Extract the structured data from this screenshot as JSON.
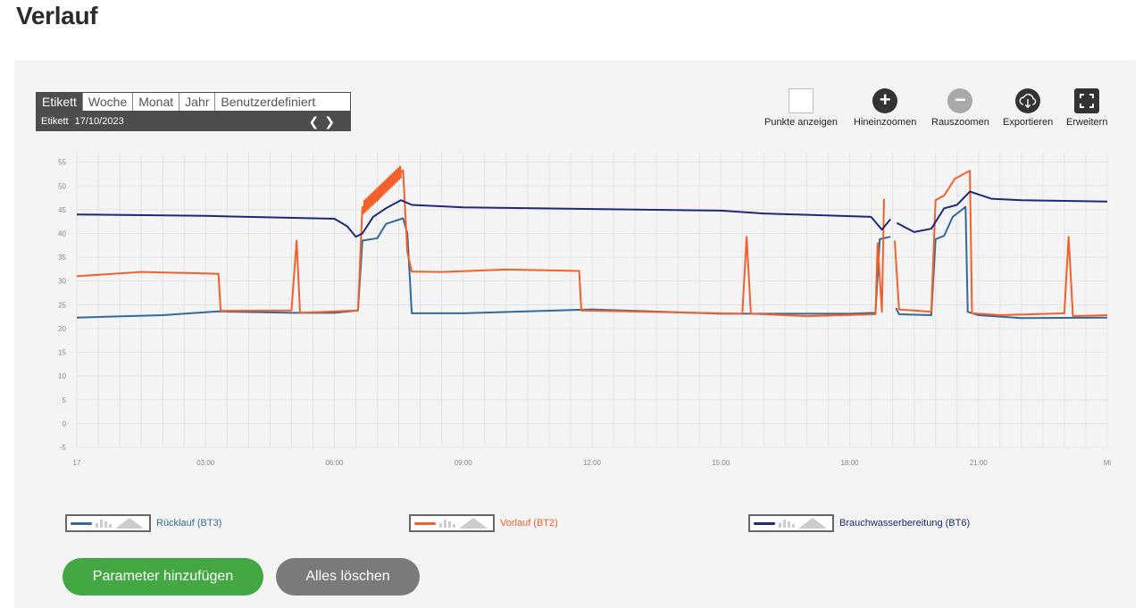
{
  "page": {
    "title": "Verlauf"
  },
  "period_tabs": [
    "Etikett",
    "Woche",
    "Monat",
    "Jahr",
    "Benutzerdefiniert"
  ],
  "date_bar": {
    "label": "Etikett",
    "date": "17/10/2023"
  },
  "toolbar": {
    "points": "Punkte anzeigen",
    "zoom_in": "Hineinzoomen",
    "zoom_out": "Rauszoomen",
    "export": "Exportieren",
    "expand": "Erweitern"
  },
  "colors": {
    "ruecklauf": "#336a9c",
    "vorlauf": "#f4602a",
    "brauchwasser": "#1c2a78"
  },
  "chart_data": {
    "type": "line",
    "x_unit": "hours",
    "x_ticks": [
      "17",
      "03:00",
      "06:00",
      "09:00",
      "12:00",
      "15:00",
      "18:00",
      "21:00",
      "Mi"
    ],
    "ylim": [
      -5,
      57
    ],
    "y_ticks": [
      -5,
      0,
      5,
      10,
      15,
      20,
      25,
      30,
      35,
      40,
      45,
      50,
      55
    ],
    "grid": true,
    "legend_position": "bottom",
    "series": [
      {
        "name": "Rücklauf (BT3)",
        "color": "#336a9c",
        "points": [
          [
            0,
            22.3
          ],
          [
            2,
            22.8
          ],
          [
            3.3,
            23.6
          ],
          [
            5,
            23.3
          ],
          [
            6,
            23.3
          ],
          [
            6.55,
            23.8
          ],
          [
            6.65,
            38.5
          ],
          [
            7.0,
            39
          ],
          [
            7.2,
            42
          ],
          [
            7.6,
            43.2
          ],
          [
            7.7,
            40
          ],
          [
            7.8,
            23.2
          ],
          [
            9,
            23.2
          ],
          [
            12,
            24
          ],
          [
            15,
            23.1
          ],
          [
            18,
            23.1
          ],
          [
            18.6,
            23.3
          ],
          [
            18.7,
            38.8
          ],
          [
            18.95,
            39.3
          ],
          [
            null,
            null
          ],
          [
            19.08,
            24.3
          ],
          [
            19.15,
            23
          ],
          [
            19.9,
            22.8
          ],
          [
            20.0,
            38.8
          ],
          [
            20.2,
            39.5
          ],
          [
            20.4,
            43.5
          ],
          [
            20.7,
            45.6
          ],
          [
            20.75,
            23.5
          ],
          [
            21,
            22.8
          ],
          [
            22,
            22.2
          ],
          [
            24,
            22.3
          ]
        ]
      },
      {
        "name": "Vorlauf (BT2)",
        "color": "#f4602a",
        "points": [
          [
            0,
            31
          ],
          [
            1.5,
            31.9
          ],
          [
            3,
            31.6
          ],
          [
            3.3,
            31.5
          ],
          [
            3.35,
            23.7
          ],
          [
            5.0,
            23.8
          ],
          [
            5.12,
            38.5
          ],
          [
            5.2,
            23.3
          ],
          [
            6.55,
            23.8
          ],
          [
            6.65,
            45.5
          ],
          [
            7.0,
            47
          ],
          [
            7.35,
            51
          ],
          [
            7.6,
            53.3
          ],
          [
            7.7,
            36
          ],
          [
            7.8,
            32
          ],
          [
            8.5,
            31.9
          ],
          [
            10,
            32.4
          ],
          [
            11.7,
            32.1
          ],
          [
            11.75,
            23.8
          ],
          [
            15.5,
            23.1
          ],
          [
            15.6,
            39.3
          ],
          [
            15.7,
            23.1
          ],
          [
            17,
            22.6
          ],
          [
            18.6,
            23
          ],
          [
            18.65,
            38
          ],
          [
            18.75,
            23.5
          ],
          [
            18.8,
            47.3
          ],
          [
            null,
            null
          ],
          [
            19.05,
            38.5
          ],
          [
            19.15,
            24
          ],
          [
            19.9,
            23.5
          ],
          [
            20.0,
            47
          ],
          [
            20.2,
            48
          ],
          [
            20.45,
            51.5
          ],
          [
            20.8,
            53.2
          ],
          [
            20.85,
            23.2
          ],
          [
            21.5,
            22.8
          ],
          [
            23,
            23.2
          ],
          [
            23.1,
            39.3
          ],
          [
            23.2,
            22.6
          ],
          [
            24,
            22.8
          ]
        ]
      },
      {
        "name": "Brauchwasserbereitung (BT6)",
        "color": "#1c2a78",
        "points": [
          [
            0,
            44
          ],
          [
            3,
            43.7
          ],
          [
            6,
            43.1
          ],
          [
            6.3,
            41.5
          ],
          [
            6.5,
            39.3
          ],
          [
            6.65,
            40
          ],
          [
            6.9,
            43.5
          ],
          [
            7.2,
            45.3
          ],
          [
            7.55,
            47
          ],
          [
            7.8,
            46
          ],
          [
            9,
            45.5
          ],
          [
            15,
            44.8
          ],
          [
            16,
            44.2
          ],
          [
            18.5,
            43.5
          ],
          [
            18.75,
            40.8
          ],
          [
            18.95,
            43
          ],
          [
            null,
            null
          ],
          [
            19.1,
            42.2
          ],
          [
            19.5,
            40.3
          ],
          [
            19.9,
            41
          ],
          [
            20.2,
            45.3
          ],
          [
            20.5,
            46
          ],
          [
            20.8,
            48.8
          ],
          [
            21.3,
            47.3
          ],
          [
            22,
            47
          ],
          [
            24,
            46.7
          ]
        ]
      }
    ]
  },
  "legend": [
    {
      "label": "Rücklauf (BT3)",
      "color": "#336a9c"
    },
    {
      "label": "Vorlauf (BT2)",
      "color": "#f4602a"
    },
    {
      "label": "Brauchwasserbereitung (BT6)",
      "color": "#1c2a78"
    }
  ],
  "buttons": {
    "add": "Parameter hinzufügen",
    "clear": "Alles löschen"
  }
}
